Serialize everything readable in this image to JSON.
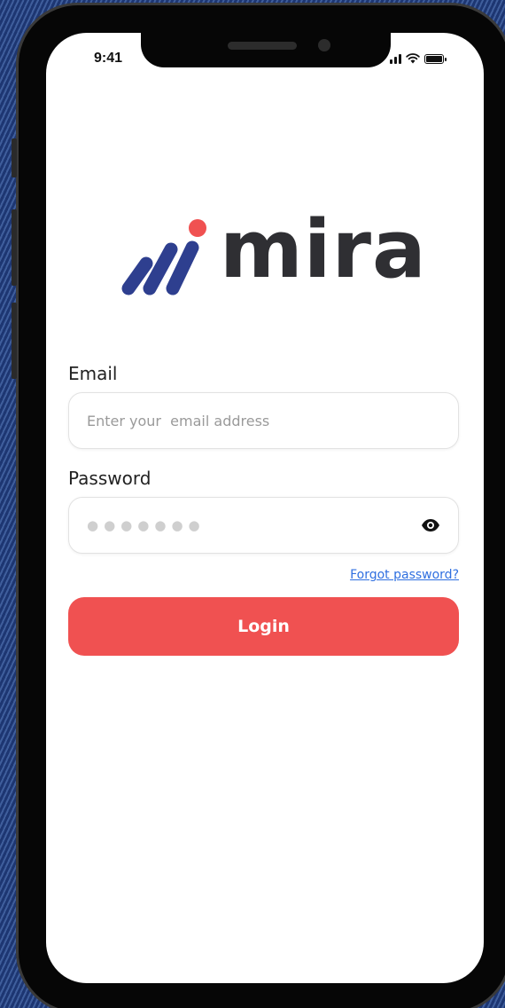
{
  "status_bar": {
    "time": "9:41"
  },
  "brand": {
    "name": "mira",
    "colors": {
      "mark_blue": "#2e3f8f",
      "mark_red": "#f05151",
      "wordmark": "#2f2f33"
    }
  },
  "login_form": {
    "email_label": "Email",
    "email_placeholder": "Enter your  email address",
    "email_value": "",
    "password_label": "Password",
    "password_mask": "●●●●●●●",
    "show_password_icon": "eye-icon",
    "forgot_password": "Forgot password?",
    "login_button": "Login"
  },
  "theme": {
    "accent": "#f05151",
    "link": "#2f6fe0",
    "background": "#1f3a78"
  }
}
